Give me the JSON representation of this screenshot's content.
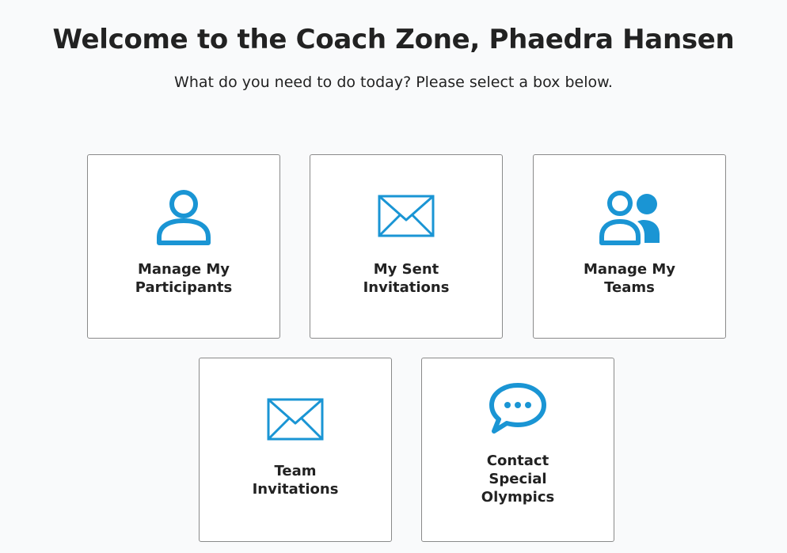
{
  "header": {
    "title": "Welcome to the Coach Zone, Phaedra Hansen",
    "subtitle": "What do you need to do today? Please select a box below."
  },
  "accent_color": "#1a95d4",
  "cards": [
    {
      "icon": "person-icon",
      "label_lines": [
        "Manage My",
        "Participants"
      ]
    },
    {
      "icon": "envelope-icon",
      "label_lines": [
        "My Sent",
        "Invitations"
      ]
    },
    {
      "icon": "people-icon",
      "label_lines": [
        "Manage My",
        "Teams"
      ]
    },
    {
      "icon": "envelope-icon",
      "label_lines": [
        "Team",
        "Invitations"
      ]
    },
    {
      "icon": "chat-bubble-icon",
      "label_lines": [
        "Contact",
        "Special",
        "Olympics"
      ]
    }
  ]
}
